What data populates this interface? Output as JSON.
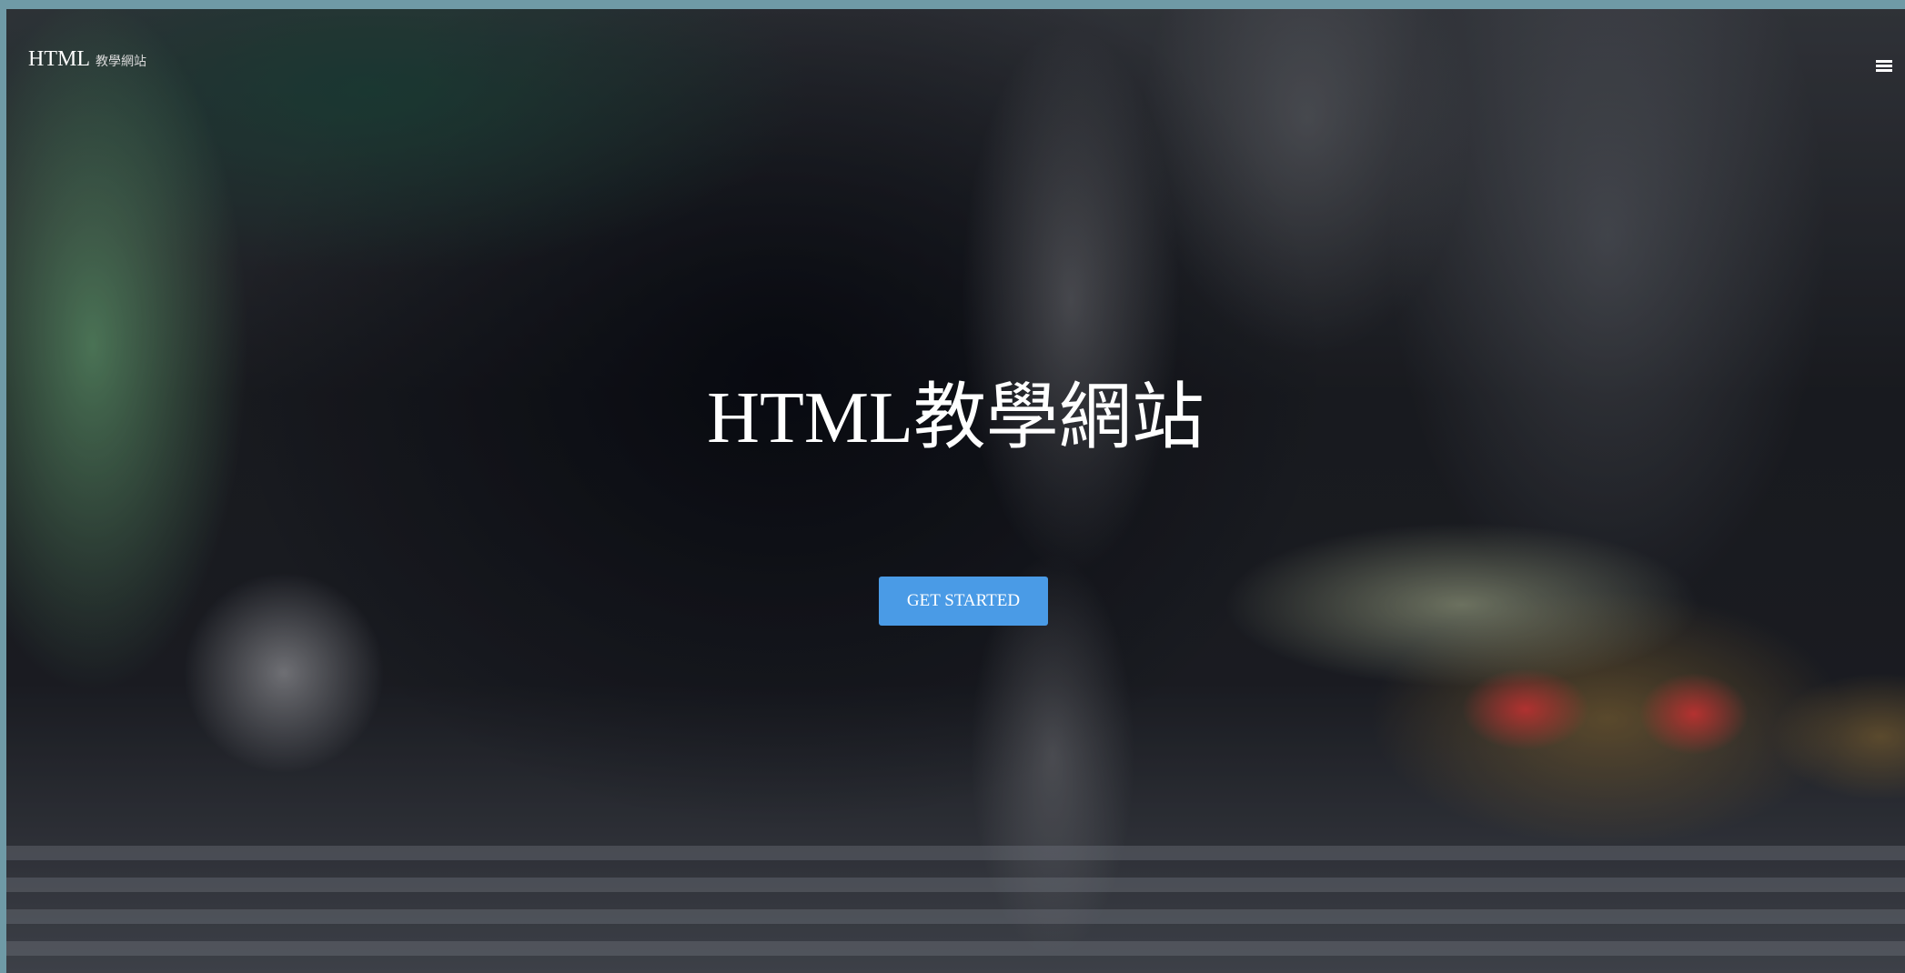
{
  "navbar": {
    "brand": "HTML",
    "brand_sub": "教學網站",
    "menu_icon": "hamburger-menu-icon"
  },
  "hero": {
    "title": "HTML教學網站",
    "cta_label": "GET STARTED",
    "cta_color": "#4a9be6"
  }
}
